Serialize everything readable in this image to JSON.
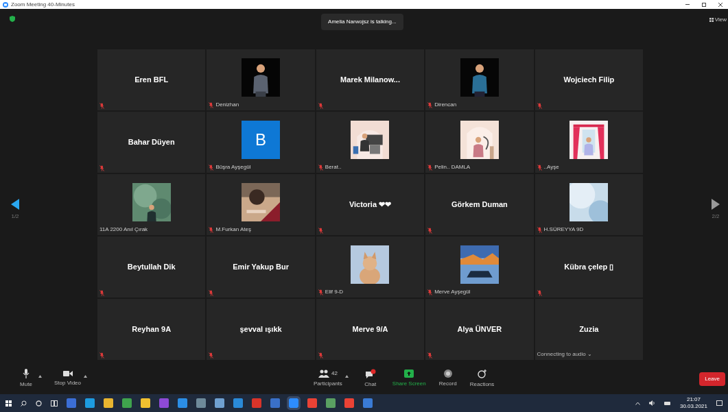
{
  "window": {
    "title": "Zoom Meeting 40-Minutes"
  },
  "meeting": {
    "talking": "Amelia Narwojsz is talking...",
    "view_button": "View"
  },
  "pager": {
    "previous": "1/2",
    "next": "2/2"
  },
  "tiles": [
    {
      "kind": "name",
      "name": "Eren BFL",
      "muted": true
    },
    {
      "kind": "picture",
      "label": "Denizhan",
      "muted": true
    },
    {
      "kind": "name",
      "name": "Marek  Milanow...",
      "muted": true
    },
    {
      "kind": "picture",
      "label": "Direncan",
      "muted": true
    },
    {
      "kind": "name",
      "name": "Wojciech Filip",
      "muted": true
    },
    {
      "kind": "name",
      "name": "Bahar Düyen",
      "muted": true
    },
    {
      "kind": "letter",
      "letter": "B",
      "label": "Büşra Ayşegül",
      "muted": true
    },
    {
      "kind": "picture",
      "label": "Berat..",
      "muted": true
    },
    {
      "kind": "picture",
      "label": "Pelin.. DAMLA",
      "muted": true
    },
    {
      "kind": "picture",
      "label": "..Ayşe",
      "muted": true
    },
    {
      "kind": "picture",
      "label": "11A 2200 Anıl Çırak",
      "muted": false
    },
    {
      "kind": "picture",
      "label": "M.Furkan Ateş",
      "muted": true
    },
    {
      "kind": "name",
      "name": "Victoria ❤❤",
      "muted": true
    },
    {
      "kind": "name",
      "name": "Görkem Duman",
      "muted": true
    },
    {
      "kind": "picture",
      "label": "H.SÜREYYA 9D",
      "muted": true
    },
    {
      "kind": "name",
      "name": "Beytullah Dik",
      "muted": true
    },
    {
      "kind": "name",
      "name": "Emir Yakup Bur",
      "muted": true
    },
    {
      "kind": "picture",
      "label": "Elif 9-D",
      "muted": true
    },
    {
      "kind": "picture",
      "label": "Merve Ayşegül",
      "muted": true
    },
    {
      "kind": "name",
      "name": "Kübra  çelep ▯",
      "muted": true
    },
    {
      "kind": "name",
      "name": "Reyhan 9A",
      "muted": true
    },
    {
      "kind": "name",
      "name": "şevval ışıkk",
      "muted": true
    },
    {
      "kind": "name",
      "name": "Merve 9/A",
      "muted": true
    },
    {
      "kind": "name",
      "name": "Alya ÜNVER",
      "muted": true
    },
    {
      "kind": "name",
      "name": "Zuzia",
      "muted": false,
      "status": "Connecting to audio ⌄"
    }
  ],
  "toolbar": [
    {
      "kind": "mute",
      "label": "Mute",
      "caret": true
    },
    {
      "kind": "video",
      "label": "Stop Video",
      "caret": true
    },
    {
      "kind": "participants",
      "label": "Participants",
      "count": "42",
      "caret": true
    },
    {
      "kind": "chat",
      "label": "Chat",
      "caret": false
    },
    {
      "kind": "share",
      "label": "Share Screen",
      "caret": false
    },
    {
      "kind": "record",
      "label": "Record",
      "caret": false
    },
    {
      "kind": "reactions",
      "label": "Reactions",
      "caret": false
    }
  ],
  "leave_button": "Leave",
  "taskbar": {
    "time": "21:07",
    "date": "30.03.2021"
  }
}
